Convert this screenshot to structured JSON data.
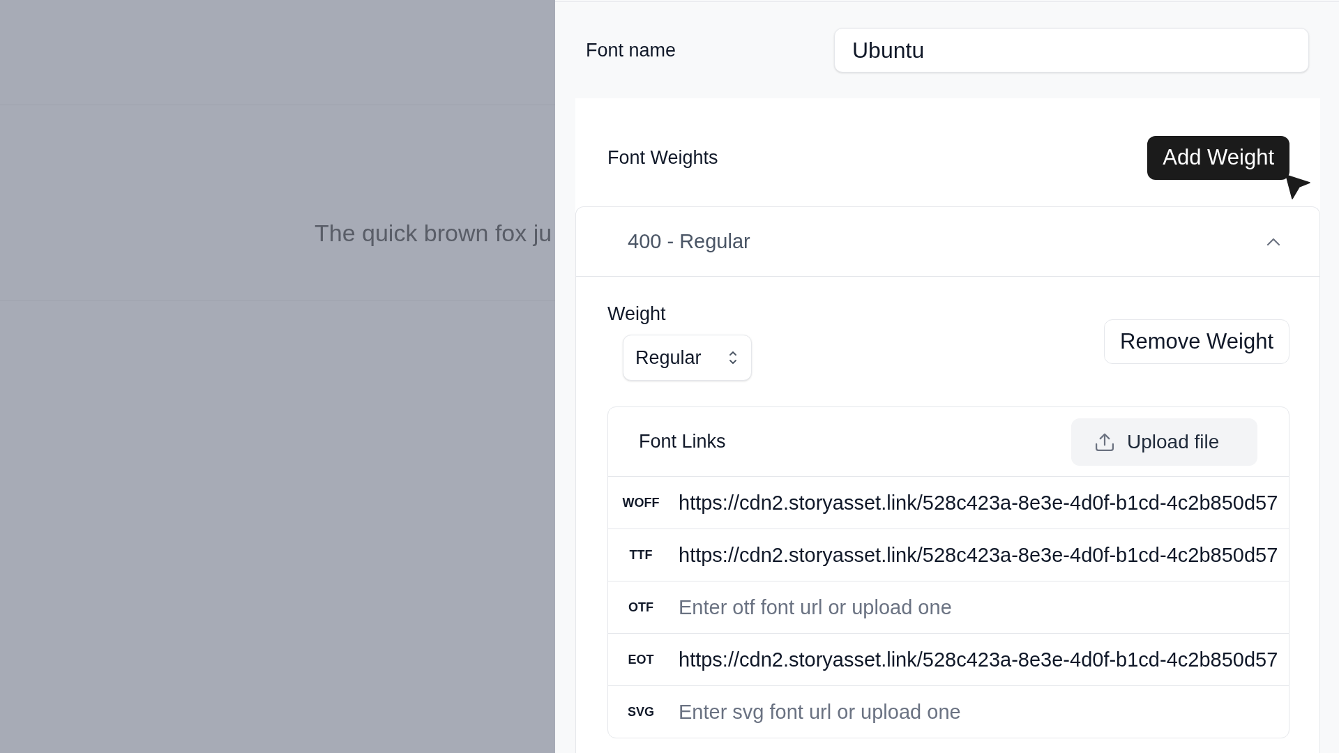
{
  "backdrop": {
    "preview_text": "The quick brown fox ju"
  },
  "panel": {
    "font_name": {
      "label": "Font name",
      "value": "Ubuntu"
    },
    "font_weights": {
      "title": "Font Weights",
      "add_button": "Add Weight",
      "items": [
        {
          "header": "400 - Regular",
          "expanded": true,
          "weight_label": "Weight",
          "weight_value": "Regular",
          "remove_button": "Remove Weight",
          "font_links": {
            "title": "Font Links",
            "upload_button": "Upload file",
            "rows": [
              {
                "format": "WOFF",
                "value": "https://cdn2.storyasset.link/528c423a-8e3e-4d0f-b1cd-4c2b850d57"
              },
              {
                "format": "TTF",
                "value": "https://cdn2.storyasset.link/528c423a-8e3e-4d0f-b1cd-4c2b850d57"
              },
              {
                "format": "OTF",
                "placeholder": "Enter otf font url or upload one"
              },
              {
                "format": "EOT",
                "value": "https://cdn2.storyasset.link/528c423a-8e3e-4d0f-b1cd-4c2b850d57"
              },
              {
                "format": "SVG",
                "placeholder": "Enter svg font url or upload one"
              }
            ]
          }
        }
      ]
    }
  }
}
